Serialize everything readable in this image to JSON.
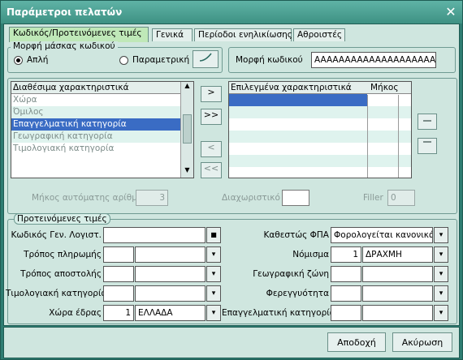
{
  "window": {
    "title": "Παράμετροι πελατών"
  },
  "tabs": [
    {
      "label": "Κωδικός/Προτεινόμενες τιμές",
      "active": true
    },
    {
      "label": "Γενικά",
      "active": false
    },
    {
      "label": "Περίοδοι ενηλικίωσης",
      "active": false
    },
    {
      "label": "Αθροιστές",
      "active": false
    }
  ],
  "mask_group": {
    "title": "Μορφή μάσκας κωδικού",
    "simple_label": "Απλή",
    "parametric_label": "Παραμετρική",
    "selected": "simple"
  },
  "code_format": {
    "label": "Μορφή κωδικού",
    "value": "AAAAAAAAAAAAAAAAAAAA"
  },
  "available": {
    "header": "Διαθέσιμα χαρακτηριστικά",
    "items": [
      "Χώρα",
      "Όμιλος",
      "Επαγγελματική κατηγορία",
      "Γεωγραφική κατηγορία",
      "Τιμολογιακή κατηγορία"
    ],
    "selected_index": 2
  },
  "selected_list": {
    "header_name": "Επιλεγμένα χαρακτηριστικά",
    "header_length": "Μήκος"
  },
  "transfer_buttons": {
    "add": ">",
    "add_all": ">>",
    "remove": "<",
    "remove_all": "<<"
  },
  "auto_number": {
    "label": "Μήκος αυτόματης αρίθμησης",
    "value": "3"
  },
  "separator": {
    "label": "Διαχωριστικό",
    "value": ""
  },
  "filler": {
    "label": "Filler",
    "value": "0"
  },
  "defaults": {
    "title": "Προτεινόμενες τιμές",
    "gl_code": {
      "label": "Κωδικός Γεν. Λογιστ.",
      "value": ""
    },
    "payment": {
      "label": "Τρόπος πληρωμής",
      "code": "",
      "name": ""
    },
    "shipping": {
      "label": "Τρόπος αποστολής",
      "code": "",
      "name": ""
    },
    "pricing": {
      "label": "Τιμολογιακή κατηγορία",
      "code": "",
      "name": ""
    },
    "country": {
      "label": "Χώρα έδρας",
      "code": "1",
      "name": "ΕΛΛΑΔΑ"
    },
    "vat": {
      "label": "Καθεστώς ΦΠΑ",
      "value": "Φορολογείται κανονικά"
    },
    "currency": {
      "label": "Νόμισμα",
      "code": "1",
      "name": "ΔΡΑΧΜΗ"
    },
    "geo": {
      "label": "Γεωγραφική ζώνη",
      "code": "",
      "name": ""
    },
    "credit": {
      "label": "Φερεγγυότητα",
      "code": "",
      "name": ""
    },
    "profession": {
      "label": "Επαγγελματική κατηγορία",
      "code": "",
      "name": ""
    }
  },
  "footer": {
    "ok": "Αποδοχή",
    "cancel": "Ακύρωση"
  }
}
